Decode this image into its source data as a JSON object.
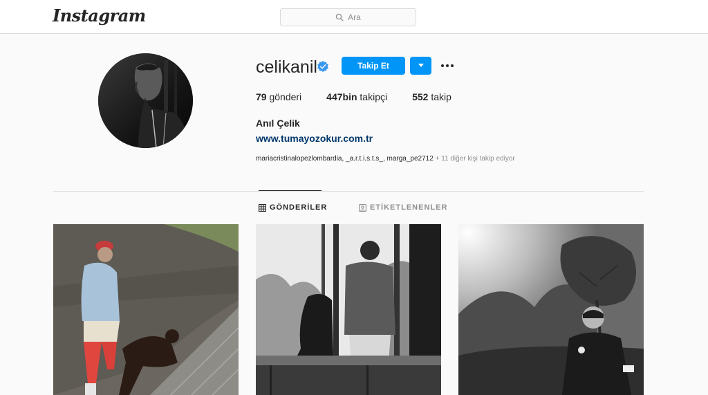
{
  "header": {
    "logo_text": "Instagram",
    "search_placeholder": "Ara"
  },
  "profile": {
    "username": "celikanil",
    "verified": true,
    "follow_label": "Takip Et",
    "stats": {
      "posts_count": "79",
      "posts_label": "gönderi",
      "followers_count": "447bin",
      "followers_label": "takipçi",
      "following_count": "552",
      "following_label": "takip"
    },
    "full_name": "Anıl Çelik",
    "website": "www.tumayozokur.com.tr",
    "followed_by_names": "mariacristinalopezlombardia, _a.r.t.i.s.t.s_, marga_pe2712",
    "followed_by_extra": " + 11 diğer kişi takip ediyor"
  },
  "tabs": [
    {
      "label": "GÖNDERİLER",
      "active": true,
      "icon": "grid-icon"
    },
    {
      "label": "ETİKETLENENLER",
      "active": false,
      "icon": "tagged-icon"
    }
  ],
  "colors": {
    "accent": "#0095f6",
    "link": "#00376b",
    "verified": "#3897f0"
  }
}
